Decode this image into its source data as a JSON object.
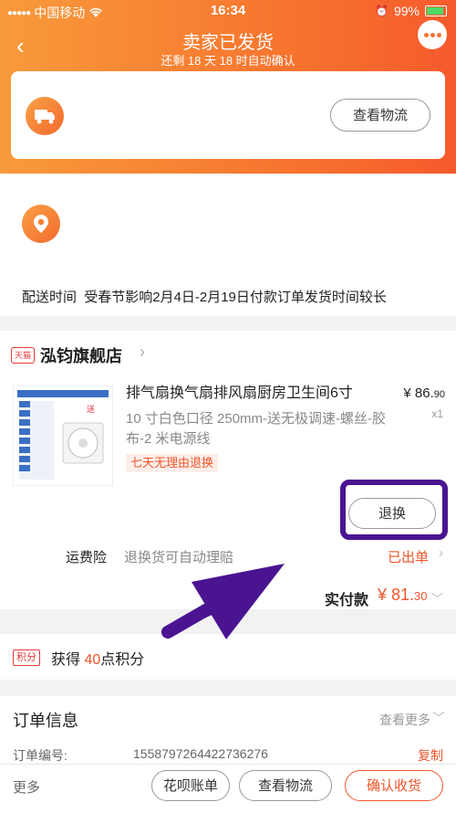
{
  "status_bar": {
    "carrier": "中国移动",
    "time": "16:34",
    "battery": "99%"
  },
  "nav": {
    "back_icon": "‹",
    "title": "卖家已发货",
    "subtitle": "还剩 18 天 18 时自动确认"
  },
  "logistics": {
    "view_button": "查看物流"
  },
  "delivery": {
    "label": "配送时间",
    "text": "受春节影响2月4日-2月19日付款订单发货时间较长"
  },
  "shop": {
    "badge": "天猫",
    "name": "泓钧旗舰店",
    "arrow": "›"
  },
  "product": {
    "title": "排气扇换气扇排风扇厨房卫生间6寸",
    "sku": "10 寸白色口径 250mm-送无极调速-螺丝-胶布-2 米电源线",
    "price_int": "¥ 86.",
    "price_dec": "90",
    "qty": "x1",
    "return_tag": "七天无理由退换",
    "refund_button": "退换"
  },
  "freight": {
    "label": "运费险",
    "desc": "退换货可自动理赔",
    "status": "已出单",
    "arrow": "›"
  },
  "total": {
    "label": "实付款",
    "value_int": "¥ 81.",
    "value_dec": "30"
  },
  "points": {
    "badge": "积分",
    "prefix": "获得",
    "amount": "40",
    "suffix": "点积分"
  },
  "order_info": {
    "title": "订单信息",
    "more": "查看更多",
    "order_no_label": "订单编号:",
    "order_no": "1558797264422736276",
    "copy": "复制"
  },
  "bottom_bar": {
    "more": "更多",
    "huabei": "花呗账单",
    "logistics": "查看物流",
    "confirm": "确认收货"
  },
  "colors": {
    "accent": "#f7762f",
    "price": "#f0562b",
    "highlight": "#4a1491"
  }
}
